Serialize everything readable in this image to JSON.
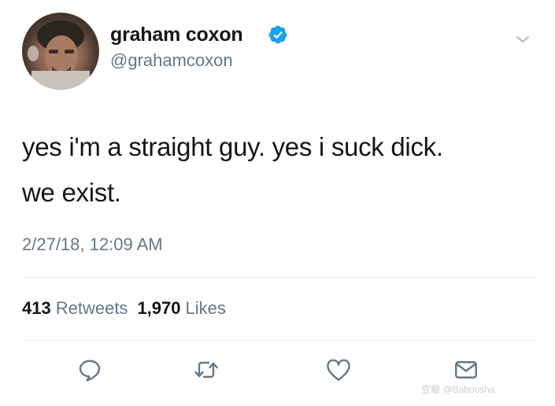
{
  "user": {
    "display_name": "graham coxon",
    "handle": "@grahamcoxon",
    "verified": true,
    "avatar_icon": "profile-photo"
  },
  "tweet": {
    "line1": "yes i'm a straight guy. yes i suck dick.",
    "line2": "we exist.",
    "timestamp": "2/27/18, 12:09 AM"
  },
  "stats": {
    "retweets_count": "413",
    "retweets_label": "Retweets",
    "likes_count": "1,970",
    "likes_label": "Likes"
  },
  "actions": [
    {
      "icon": "reply-icon"
    },
    {
      "icon": "retweet-icon"
    },
    {
      "icon": "like-icon"
    },
    {
      "icon": "message-icon"
    }
  ],
  "watermark": {
    "text": "豆瓣 @Baboosha"
  },
  "colors": {
    "text_primary": "#14171a",
    "text_secondary": "#657786",
    "verified_blue": "#1da1f2",
    "divider": "#e6ecf0"
  }
}
